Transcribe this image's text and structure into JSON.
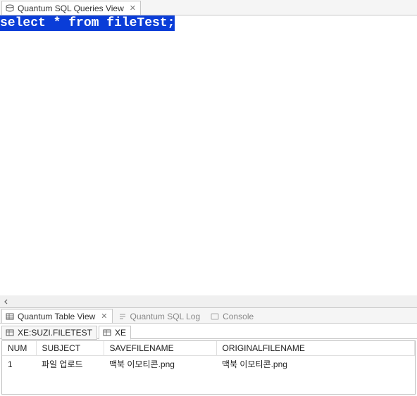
{
  "top": {
    "tab_label": "Quantum SQL Queries View",
    "sql": "select * from fileTest;"
  },
  "bottom": {
    "views": [
      {
        "label": "Quantum Table View",
        "active": true
      },
      {
        "label": "Quantum SQL Log",
        "active": false
      },
      {
        "label": "Console",
        "active": false
      }
    ],
    "subtabs": [
      {
        "label": "XE:SUZI.FILETEST",
        "active": false
      },
      {
        "label": "XE",
        "active": true
      }
    ],
    "columns": [
      "NUM",
      "SUBJECT",
      "SAVEFILENAME",
      "ORIGINALFILENAME"
    ],
    "rows": [
      [
        "1",
        "파일 업로드",
        "맥북 이모티콘.png",
        "맥북 이모티콘.png"
      ]
    ]
  }
}
